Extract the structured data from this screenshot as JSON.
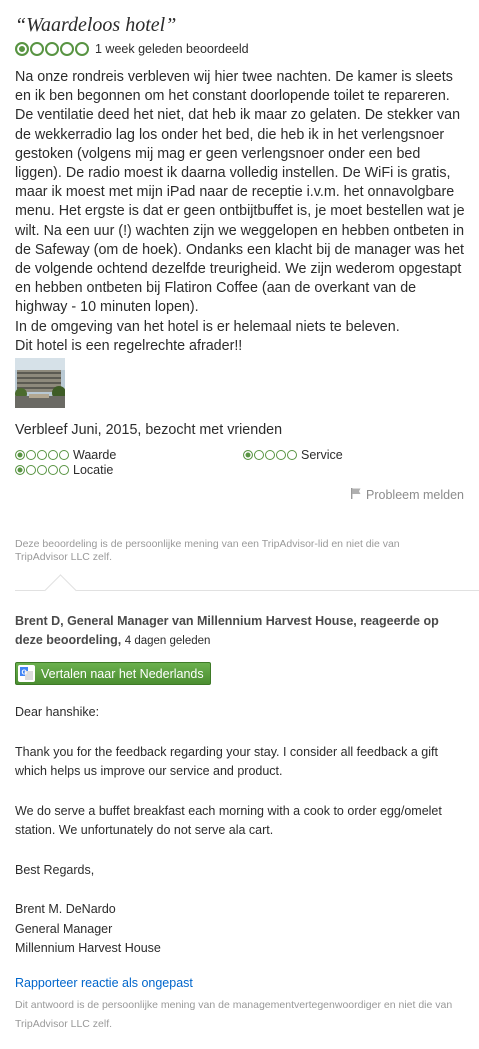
{
  "review": {
    "title": "“Waardeloos hotel”",
    "rating": 1,
    "rating_max": 5,
    "date_text": "1 week geleden beoordeeld",
    "paragraphs": [
      "Na onze rondreis verbleven wij hier twee nachten. De kamer is sleets en ik ben begonnen om het constant doorlopende toilet te repareren. De ventilatie deed het niet, dat heb ik maar zo gelaten. De stekker van de wekkerradio lag los onder het bed, die heb ik in het verlengsnoer gestoken (volgens mij mag er geen verlengsnoer onder een bed liggen). De radio moest ik daarna volledig instellen. De WiFi is gratis, maar ik moest met mijn iPad naar de receptie i.v.m. het onnavolgbare menu. Het ergste is dat er geen ontbijtbuffet is, je moet bestellen wat je wilt. Na een uur (!) wachten zijn we weggelopen en hebben ontbeten in de Safeway (om de hoek). Ondanks een klacht bij de manager was het de volgende ochtend dezelfde treurigheid. We zijn wederom opgestapt en hebben ontbeten bij Flatiron Coffee (aan de overkant van de highway - 10 minuten lopen).",
      "In de omgeving van het hotel is er helemaal niets te beleven.",
      "Dit hotel is een regelrechte afrader!!"
    ],
    "stay_text": "Verbleef Juni, 2015, bezocht met vrienden",
    "sub_ratings": [
      {
        "label": "Waarde",
        "rating": 1
      },
      {
        "label": "Service",
        "rating": 1
      },
      {
        "label": "Locatie",
        "rating": 1
      }
    ],
    "report_label": "Probleem melden",
    "disclaimer": "Deze beoordeling is de persoonlijke mening van een TripAdvisor-lid en niet die van TripAdvisor LLC zelf."
  },
  "response": {
    "responder": "Brent D, General Manager van Millennium Harvest House, reageerde op deze beoordeling,",
    "ago": "4 dagen geleden",
    "translate_label": "Vertalen naar het Nederlands",
    "greeting": "Dear hanshike:",
    "paragraphs": [
      "Thank you for the feedback regarding your stay. I consider all feedback a gift which helps us improve our service and product.",
      "We do serve a buffet breakfast each morning with a cook to order egg/omelet station. We unfortunately do not serve ala cart.",
      "Best Regards,"
    ],
    "signature": [
      "Brent M. DeNardo",
      "General Manager",
      "Millennium Harvest House"
    ],
    "report_label": "Rapporteer reactie als ongepast",
    "disclaimer": "Dit antwoord is de persoonlijke mening van de managementvertegenwoordiger en niet die van TripAdvisor LLC zelf."
  },
  "colors": {
    "bubble": "#589442",
    "link": "#0066cc",
    "button_green": "#4b8e31"
  }
}
